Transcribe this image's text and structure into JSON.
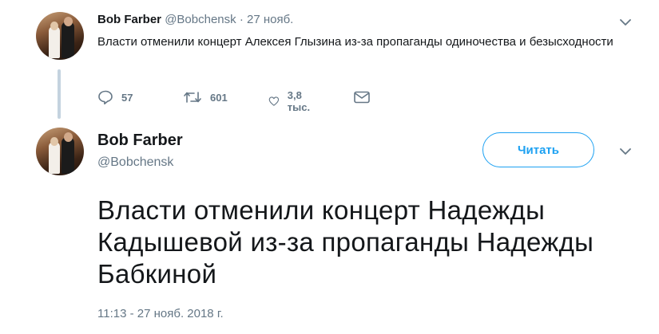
{
  "tweet1": {
    "name": "Bob Farber",
    "handle": "@Bobchensk",
    "separator": "·",
    "date": "27 нояб.",
    "text": "Власти отменили концерт Алексея Глызина из-за пропаганды одиночества и безысходности",
    "replies": "57",
    "retweets": "601",
    "likes": "3,8 тыс."
  },
  "tweet2": {
    "name": "Bob Farber",
    "handle": "@Bobchensk",
    "follow_label": "Читать",
    "text": "Власти отменили концерт Надежды Кадышевой из-за пропаганды Надежды Бабкиной",
    "timestamp": "11:13 - 27 нояб. 2018 г."
  },
  "colors": {
    "accent": "#1da1f2",
    "secondary_text": "#657786",
    "primary_text": "#14171a",
    "thread_line": "#c4d3df"
  },
  "icons": [
    "reply-icon",
    "retweet-icon",
    "like-icon",
    "direct-message-icon",
    "chevron-down-icon",
    "avatar"
  ]
}
